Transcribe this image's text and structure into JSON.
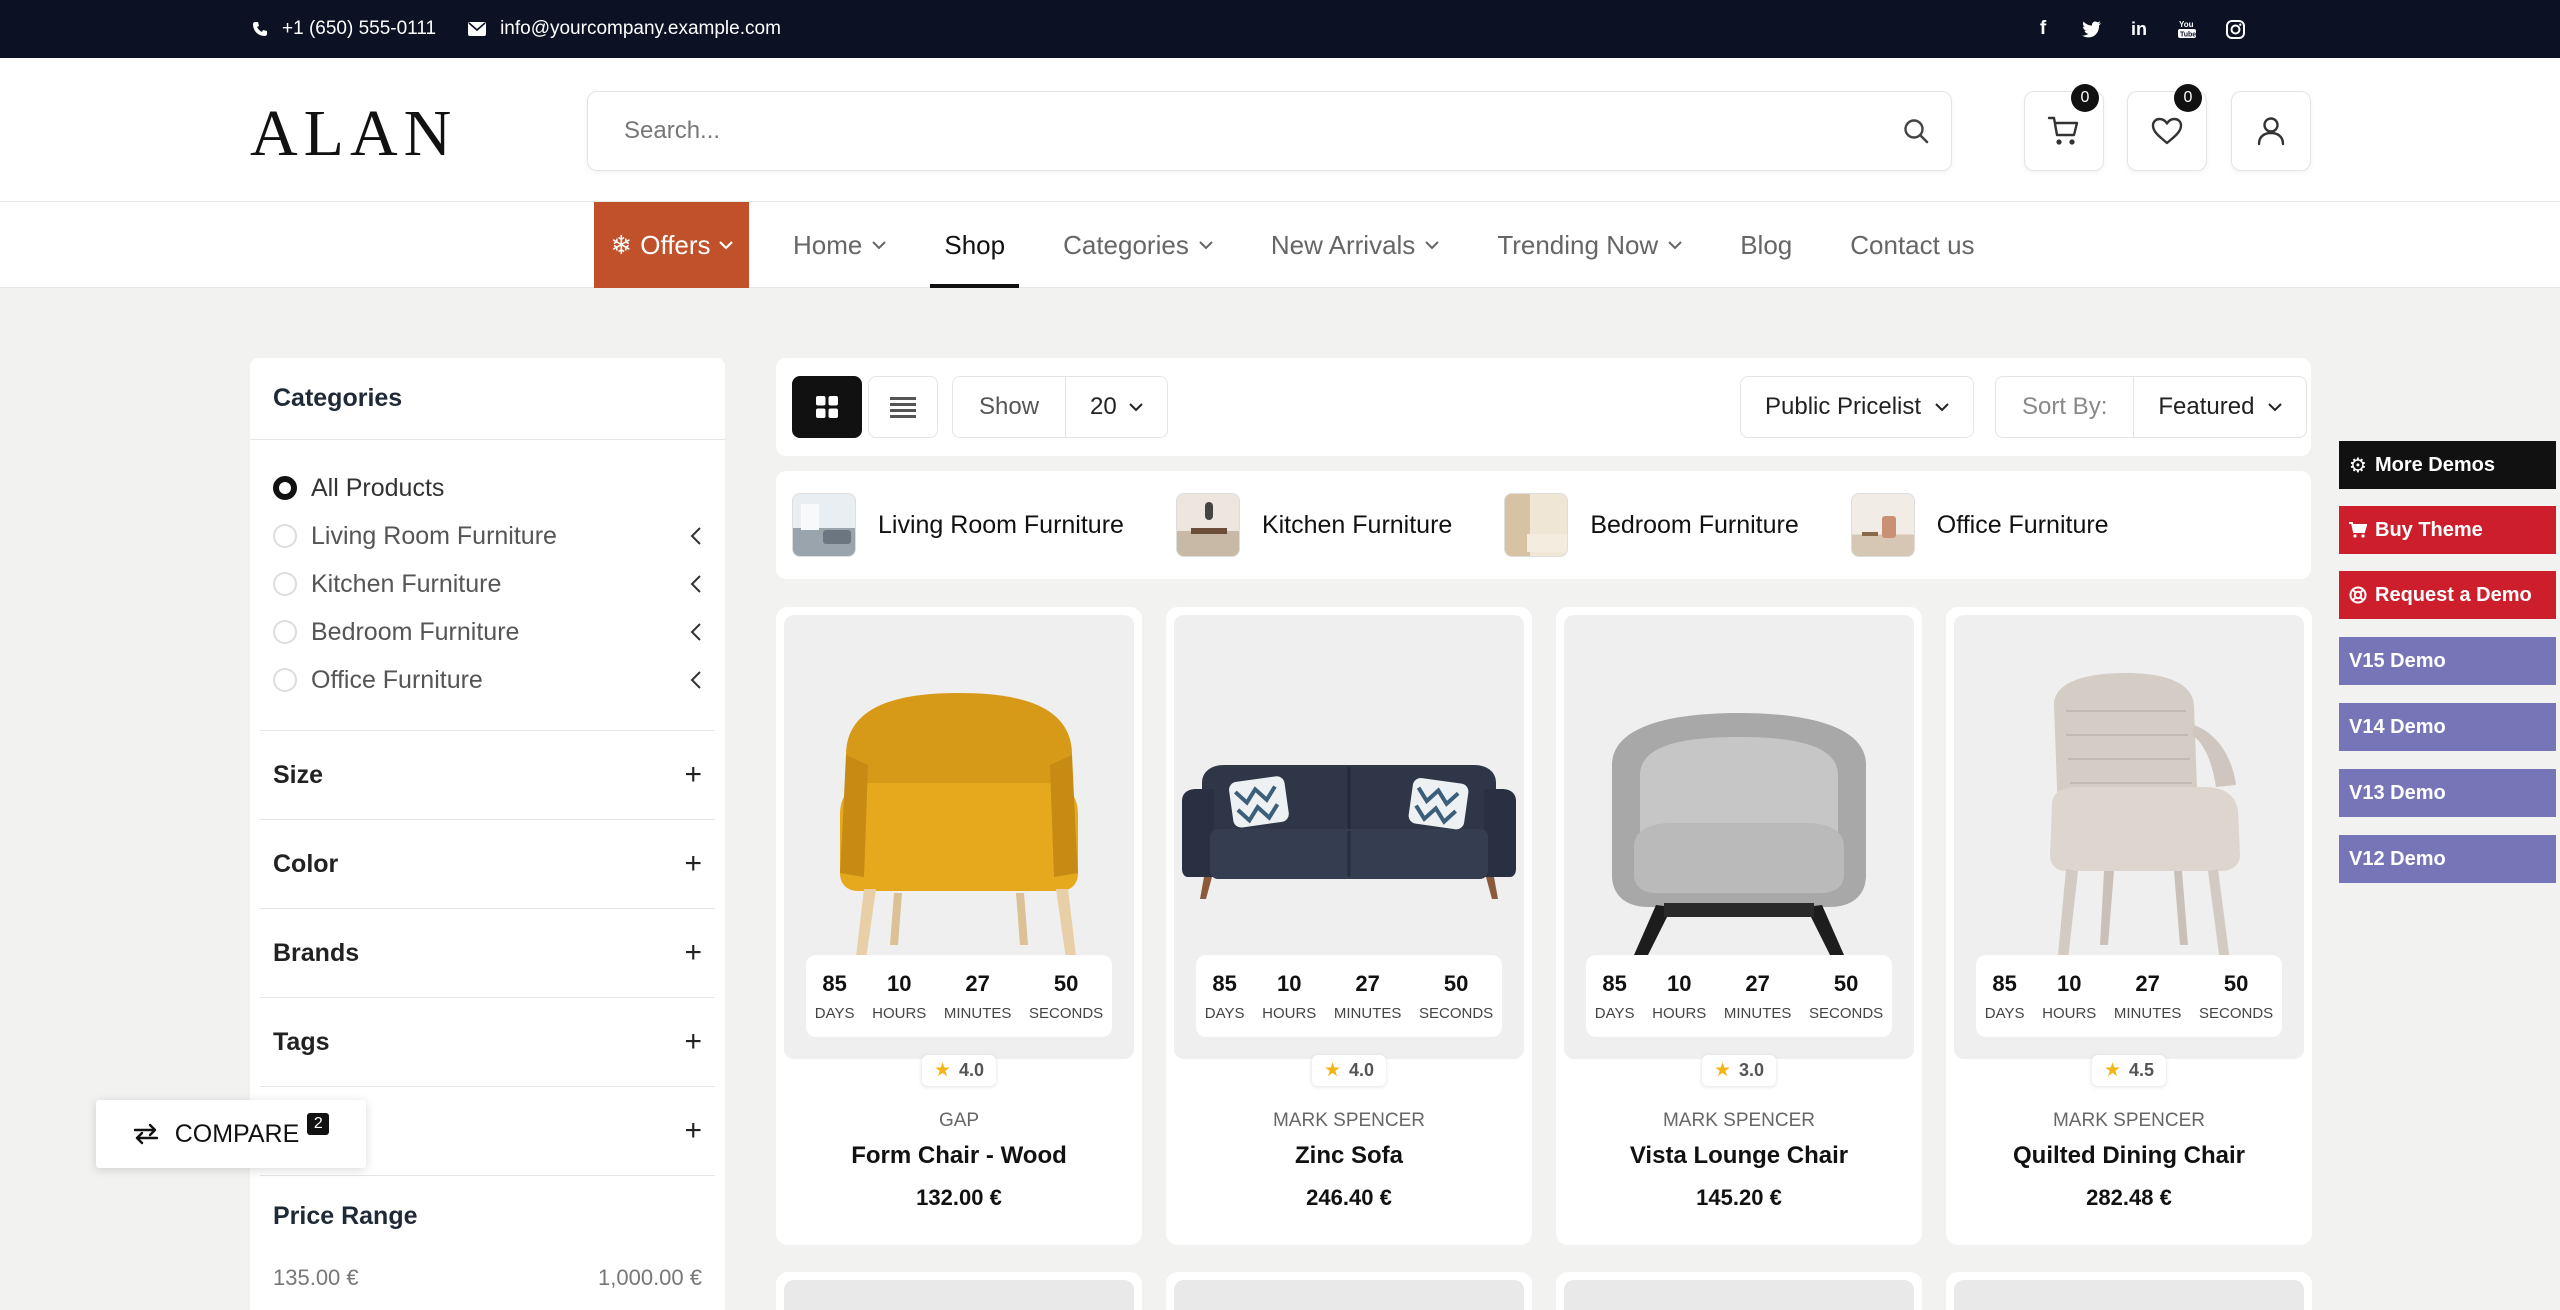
{
  "topbar": {
    "phone": "+1 (650) 555-0111",
    "email": "info@yourcompany.example.com",
    "social": [
      "facebook-icon",
      "twitter-icon",
      "linkedin-icon",
      "youtube-icon",
      "instagram-icon"
    ]
  },
  "header": {
    "logo": "ALAN",
    "search_placeholder": "Search...",
    "cart_count": "0",
    "wishlist_count": "0"
  },
  "nav": {
    "offers": "Offers",
    "links": [
      {
        "label": "Home",
        "dropdown": true
      },
      {
        "label": "Shop",
        "dropdown": false,
        "active": true
      },
      {
        "label": "Categories",
        "dropdown": true
      },
      {
        "label": "New Arrivals",
        "dropdown": true
      },
      {
        "label": "Trending Now",
        "dropdown": true
      },
      {
        "label": "Blog",
        "dropdown": false
      },
      {
        "label": "Contact us",
        "dropdown": false
      }
    ]
  },
  "sidebar": {
    "categories_title": "Categories",
    "categories": [
      {
        "label": "All Products",
        "selected": true
      },
      {
        "label": "Living Room Furniture"
      },
      {
        "label": "Kitchen Furniture"
      },
      {
        "label": "Bedroom Furniture"
      },
      {
        "label": "Office Furniture"
      }
    ],
    "facets": [
      "Size",
      "Color",
      "Brands",
      "Tags",
      ""
    ],
    "price_title": "Price Range",
    "price_min": "135.00 €",
    "price_max": "1,000.00 €"
  },
  "compare": {
    "label": "COMPARE",
    "count": "2"
  },
  "toolbar": {
    "show_label": "Show",
    "show_value": "20",
    "pricelist": "Public Pricelist",
    "sort_label": "Sort By:",
    "sort_value": "Featured"
  },
  "category_strip": [
    {
      "label": "Living Room Furniture"
    },
    {
      "label": "Kitchen Furniture"
    },
    {
      "label": "Bedroom Furniture"
    },
    {
      "label": "Office Furniture"
    }
  ],
  "timer_labels": {
    "days": "DAYS",
    "hours": "HOURS",
    "minutes": "MINUTES",
    "seconds": "SECONDS"
  },
  "products": [
    {
      "brand": "GAP",
      "name": "Form Chair - Wood",
      "price": "132.00 €",
      "rating": "4.0",
      "days": "85",
      "hours": "10",
      "minutes": "27",
      "seconds": "50"
    },
    {
      "brand": "MARK SPENCER",
      "name": "Zinc Sofa",
      "price": "246.40 €",
      "rating": "4.0",
      "days": "85",
      "hours": "10",
      "minutes": "27",
      "seconds": "50"
    },
    {
      "brand": "MARK SPENCER",
      "name": "Vista Lounge Chair",
      "price": "145.20 €",
      "rating": "3.0",
      "days": "85",
      "hours": "10",
      "minutes": "27",
      "seconds": "50"
    },
    {
      "brand": "MARK SPENCER",
      "name": "Quilted Dining Chair",
      "price": "282.48 €",
      "rating": "4.5",
      "days": "85",
      "hours": "10",
      "minutes": "27",
      "seconds": "50"
    }
  ],
  "demo_panel": [
    {
      "label": "More Demos",
      "icon": "gear-icon",
      "style": "black"
    },
    {
      "label": "Buy Theme",
      "icon": "cart-icon",
      "style": "red"
    },
    {
      "label": "Request a Demo",
      "icon": "lifebuoy-icon",
      "style": "red"
    },
    {
      "label": "V15 Demo",
      "style": "purple"
    },
    {
      "label": "V14 Demo",
      "style": "purple"
    },
    {
      "label": "V13 Demo",
      "style": "purple"
    },
    {
      "label": "V12 Demo",
      "style": "purple"
    }
  ],
  "colors": {
    "topbar": "#0c1124",
    "offers": "#c0512b",
    "demo_red": "#cc1f2b",
    "demo_purple": "#7575b8",
    "star": "#f3b414"
  }
}
